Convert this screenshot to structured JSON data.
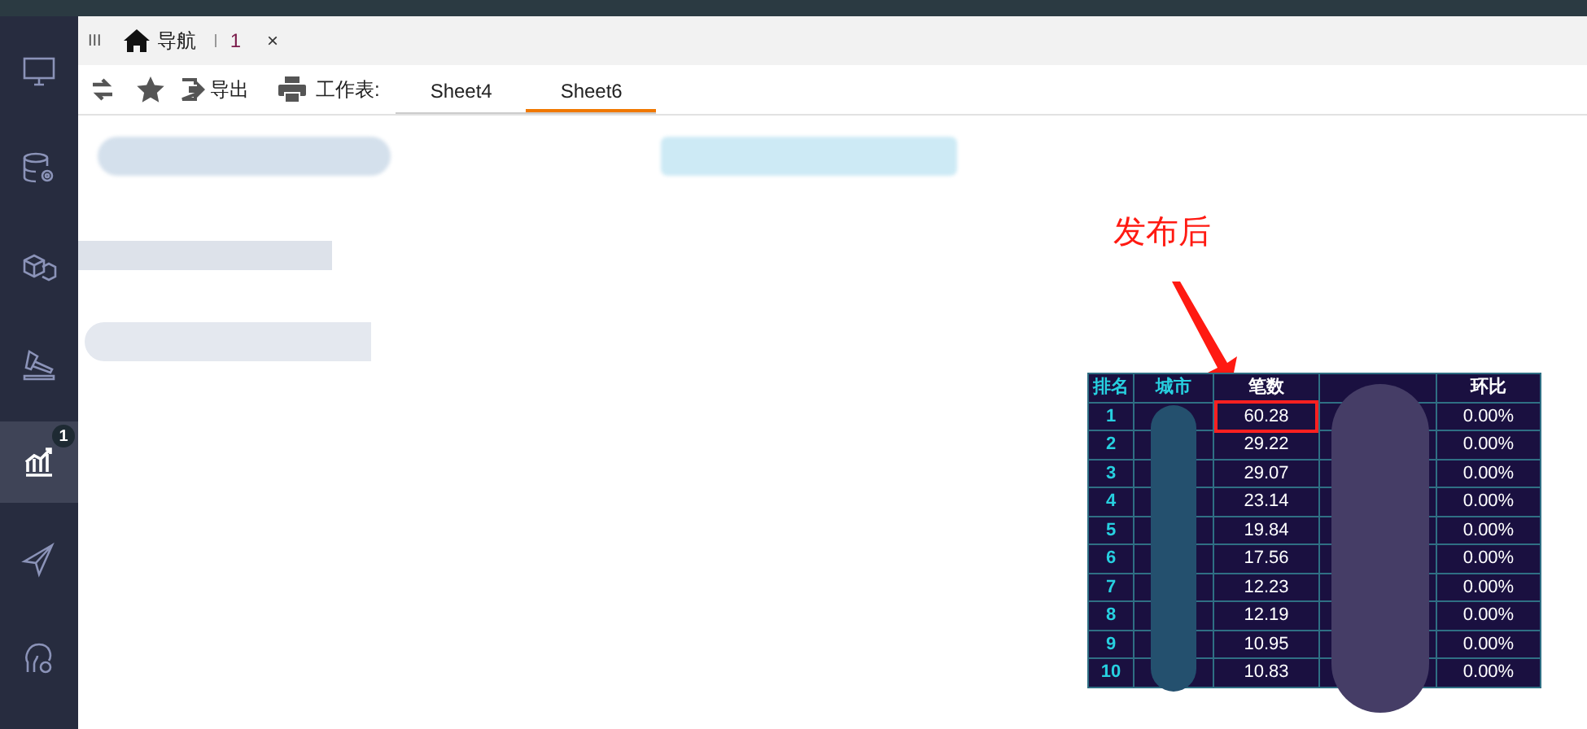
{
  "sidebar": {
    "items": [
      {
        "kind": "monitor",
        "selected": false
      },
      {
        "kind": "database",
        "selected": false
      },
      {
        "kind": "cubes",
        "selected": false
      },
      {
        "kind": "hammer",
        "selected": false
      },
      {
        "kind": "chart",
        "selected": true,
        "badge": "1"
      },
      {
        "kind": "plane",
        "selected": false
      },
      {
        "kind": "user-gear",
        "selected": false
      }
    ]
  },
  "tab_bar": {
    "grip": "III",
    "tabs": [
      {
        "label": "导航",
        "kind": "home"
      },
      {
        "label": "1",
        "kind": "page",
        "close": "×"
      }
    ]
  },
  "toolbar": {
    "export": "导出",
    "sheet_label": "工作表:",
    "sheets": [
      {
        "label": "Sheet4",
        "selected": false
      },
      {
        "label": "Sheet6",
        "selected": true
      }
    ]
  },
  "annotation": {
    "text": "发布后"
  },
  "table": {
    "columns": [
      "排名",
      "城市",
      "笔数",
      "",
      "环比"
    ],
    "rows": [
      {
        "rank": "1",
        "count": "60.28",
        "ratio": "0.00%",
        "highlighted": true
      },
      {
        "rank": "2",
        "count": "29.22",
        "ratio": "0.00%",
        "highlighted": false
      },
      {
        "rank": "3",
        "count": "29.07",
        "ratio": "0.00%",
        "highlighted": false
      },
      {
        "rank": "4",
        "count": "23.14",
        "ratio": "0.00%",
        "highlighted": false
      },
      {
        "rank": "5",
        "count": "19.84",
        "ratio": "0.00%",
        "highlighted": false
      },
      {
        "rank": "6",
        "count": "17.56",
        "ratio": "0.00%",
        "highlighted": false
      },
      {
        "rank": "7",
        "count": "12.23",
        "ratio": "0.00%",
        "highlighted": false
      },
      {
        "rank": "8",
        "count": "12.19",
        "ratio": "0.00%",
        "highlighted": false
      },
      {
        "rank": "9",
        "count": "10.95",
        "ratio": "0.00%",
        "highlighted": false
      },
      {
        "rank": "10",
        "count": "10.83",
        "ratio": "0.00%",
        "highlighted": false
      }
    ]
  }
}
